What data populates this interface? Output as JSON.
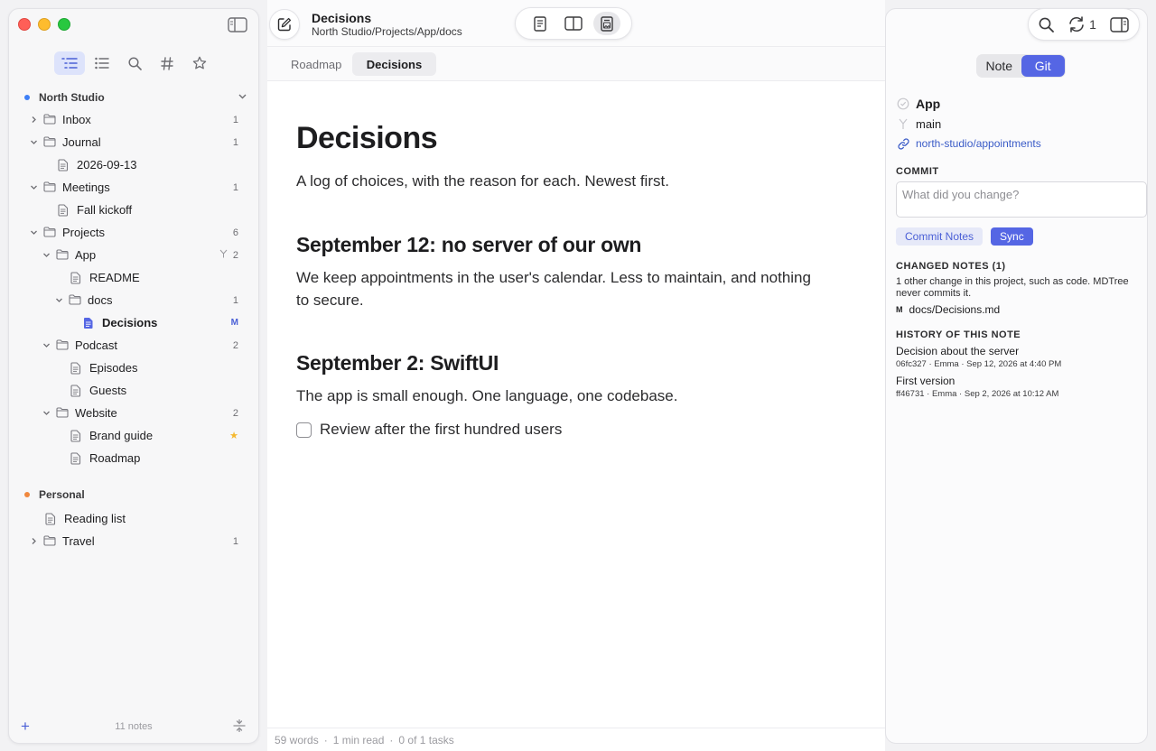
{
  "sidebar": {
    "workspaces": [
      {
        "name": "North Studio",
        "color": "#3d7ff6",
        "rows": [
          {
            "label": "Inbox",
            "type": "folder",
            "depth": 0,
            "chevron": "right",
            "count": "1"
          },
          {
            "label": "Journal",
            "type": "folder",
            "depth": 0,
            "chevron": "down",
            "count": "1"
          },
          {
            "label": "2026-09-13",
            "type": "note",
            "depth": 1
          },
          {
            "label": "Meetings",
            "type": "folder",
            "depth": 0,
            "chevron": "down",
            "count": "1"
          },
          {
            "label": "Fall kickoff",
            "type": "note",
            "depth": 1
          },
          {
            "label": "Projects",
            "type": "folder",
            "depth": 0,
            "chevron": "down",
            "count": "6"
          },
          {
            "label": "App",
            "type": "folder",
            "depth": 1,
            "chevron": "down",
            "count": "2",
            "branch": true
          },
          {
            "label": "README",
            "type": "note",
            "depth": 2
          },
          {
            "label": "docs",
            "type": "folder",
            "depth": 2,
            "chevron": "down",
            "count": "1"
          },
          {
            "label": "Decisions",
            "type": "note",
            "depth": 3,
            "selected": true,
            "badge": "M"
          },
          {
            "label": "Podcast",
            "type": "folder",
            "depth": 1,
            "chevron": "down",
            "count": "2"
          },
          {
            "label": "Episodes",
            "type": "note",
            "depth": 2
          },
          {
            "label": "Guests",
            "type": "note",
            "depth": 2
          },
          {
            "label": "Website",
            "type": "folder",
            "depth": 1,
            "chevron": "down",
            "count": "2"
          },
          {
            "label": "Brand guide",
            "type": "note",
            "depth": 2,
            "star": true
          },
          {
            "label": "Roadmap",
            "type": "note",
            "depth": 2
          }
        ]
      },
      {
        "name": "Personal",
        "color": "#f0883e",
        "rows": [
          {
            "label": "Reading list",
            "type": "note",
            "depth": 0
          },
          {
            "label": "Travel",
            "type": "folder",
            "depth": 0,
            "chevron": "right",
            "count": "1"
          }
        ]
      }
    ],
    "footer": {
      "notes_count": "11 notes"
    }
  },
  "header": {
    "title": "Decisions",
    "path": "North Studio/Projects/App/docs"
  },
  "tabs": [
    {
      "label": "Roadmap",
      "active": false
    },
    {
      "label": "Decisions",
      "active": true
    }
  ],
  "document": {
    "h1": "Decisions",
    "intro": "A log of choices, with the reason for each. Newest first.",
    "sections": [
      {
        "heading": "September 12: no server of our own",
        "body": "We keep appointments in the user's calendar. Less to maintain, and nothing to secure."
      },
      {
        "heading": "September 2: SwiftUI",
        "body": "The app is small enough. One language, one codebase."
      }
    ],
    "task": "Review after the first hundred users"
  },
  "status": {
    "words": "59 words",
    "read": "1 min read",
    "tasks": "0 of 1 tasks",
    "sep": "·"
  },
  "inspector": {
    "sync_count": "1",
    "segments": {
      "note": "Note",
      "git": "Git"
    },
    "repo": "App",
    "branch": "main",
    "remote": "north-studio/appointments",
    "commit_label": "COMMIT",
    "commit_placeholder": "What did you change?",
    "commit_notes_btn": "Commit Notes",
    "sync_btn": "Sync",
    "changed_label": "CHANGED NOTES (1)",
    "changed_info": "1 other change in this project, such as code. MDTree never commits it.",
    "changed_file_badge": "M",
    "changed_file": "docs/Decisions.md",
    "history_label": "HISTORY OF THIS NOTE",
    "history": [
      {
        "title": "Decision about the server",
        "meta": "06fc327 · Emma · Sep 12, 2026 at 4:40 PM"
      },
      {
        "title": "First version",
        "meta": "ff46731 · Emma · Sep 2, 2026 at 10:12 AM"
      }
    ]
  }
}
